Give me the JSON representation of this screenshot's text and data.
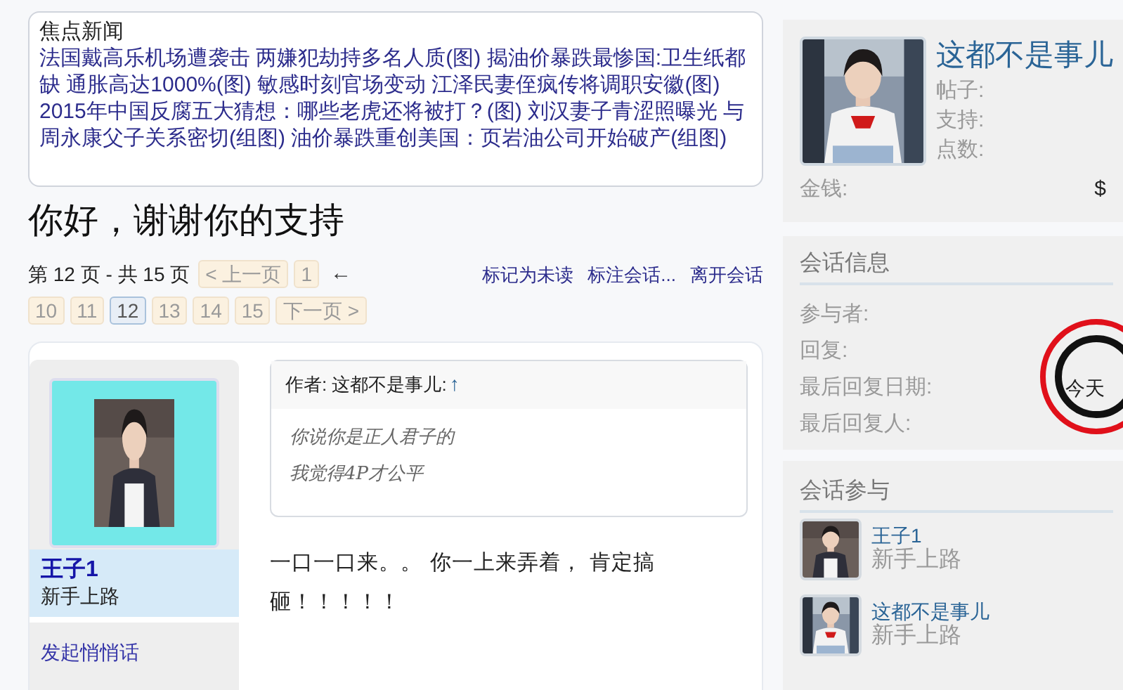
{
  "news": {
    "title": "焦点新闻",
    "text": "法国戴高乐机场遭袭击 两嫌犯劫持多名人质(图) 揭油价暴跌最惨国:卫生纸都缺 通胀高达1000%(图) 敏感时刻官场变动 江泽民妻侄疯传将调职安徽(图) 2015年中国反腐五大猜想：哪些老虎还将被打？(图) 刘汉妻子青涩照曝光 与周永康父子关系密切(组图) 油价暴跌重创美国：页岩油公司开始破产(组图)"
  },
  "title": "你好，谢谢你的支持",
  "pagination": {
    "summary": "第 12 页 - 共 15 页",
    "items": [
      {
        "kind": "button",
        "label": "< 上一页",
        "selected": false
      },
      {
        "kind": "button",
        "label": "1",
        "selected": false
      },
      {
        "kind": "jump",
        "label": "←"
      },
      {
        "kind": "button",
        "label": "10",
        "selected": false
      },
      {
        "kind": "button",
        "label": "11",
        "selected": false
      },
      {
        "kind": "button",
        "label": "12",
        "selected": true
      },
      {
        "kind": "button",
        "label": "13",
        "selected": false
      },
      {
        "kind": "button",
        "label": "14",
        "selected": false
      },
      {
        "kind": "button",
        "label": "15",
        "selected": false
      },
      {
        "kind": "button",
        "label": "下一页 >",
        "selected": false
      }
    ]
  },
  "actions": [
    "标记为未读",
    "标注会话...",
    "离开会话"
  ],
  "post": {
    "author": "王子1",
    "rank": "新手上路",
    "whisper_link": "发起悄悄话",
    "quote": {
      "header": "作者: 这都不是事儿:",
      "jump": "↑",
      "lines": [
        "你说你是正人君子的",
        "我觉得4P才公平"
      ]
    },
    "body": "一口一口来。。 你一上来弄着， 肯定搞砸！！！！！"
  },
  "profile": {
    "name": "这都不是事儿",
    "stats": [
      "帖子:",
      "支持:",
      "点数:"
    ],
    "money_label": "金钱:",
    "money_value": "$"
  },
  "conversation_info": {
    "title": "会话信息",
    "rows": [
      {
        "label": "参与者:"
      },
      {
        "label": "回复:"
      },
      {
        "label": "最后回复日期:",
        "value": "今天"
      },
      {
        "label": "最后回复人:"
      }
    ]
  },
  "participants": {
    "title": "会话参与",
    "items": [
      {
        "name": "王子1",
        "rank": "新手上路"
      },
      {
        "name": "这都不是事儿",
        "rank": "新手上路"
      }
    ]
  }
}
